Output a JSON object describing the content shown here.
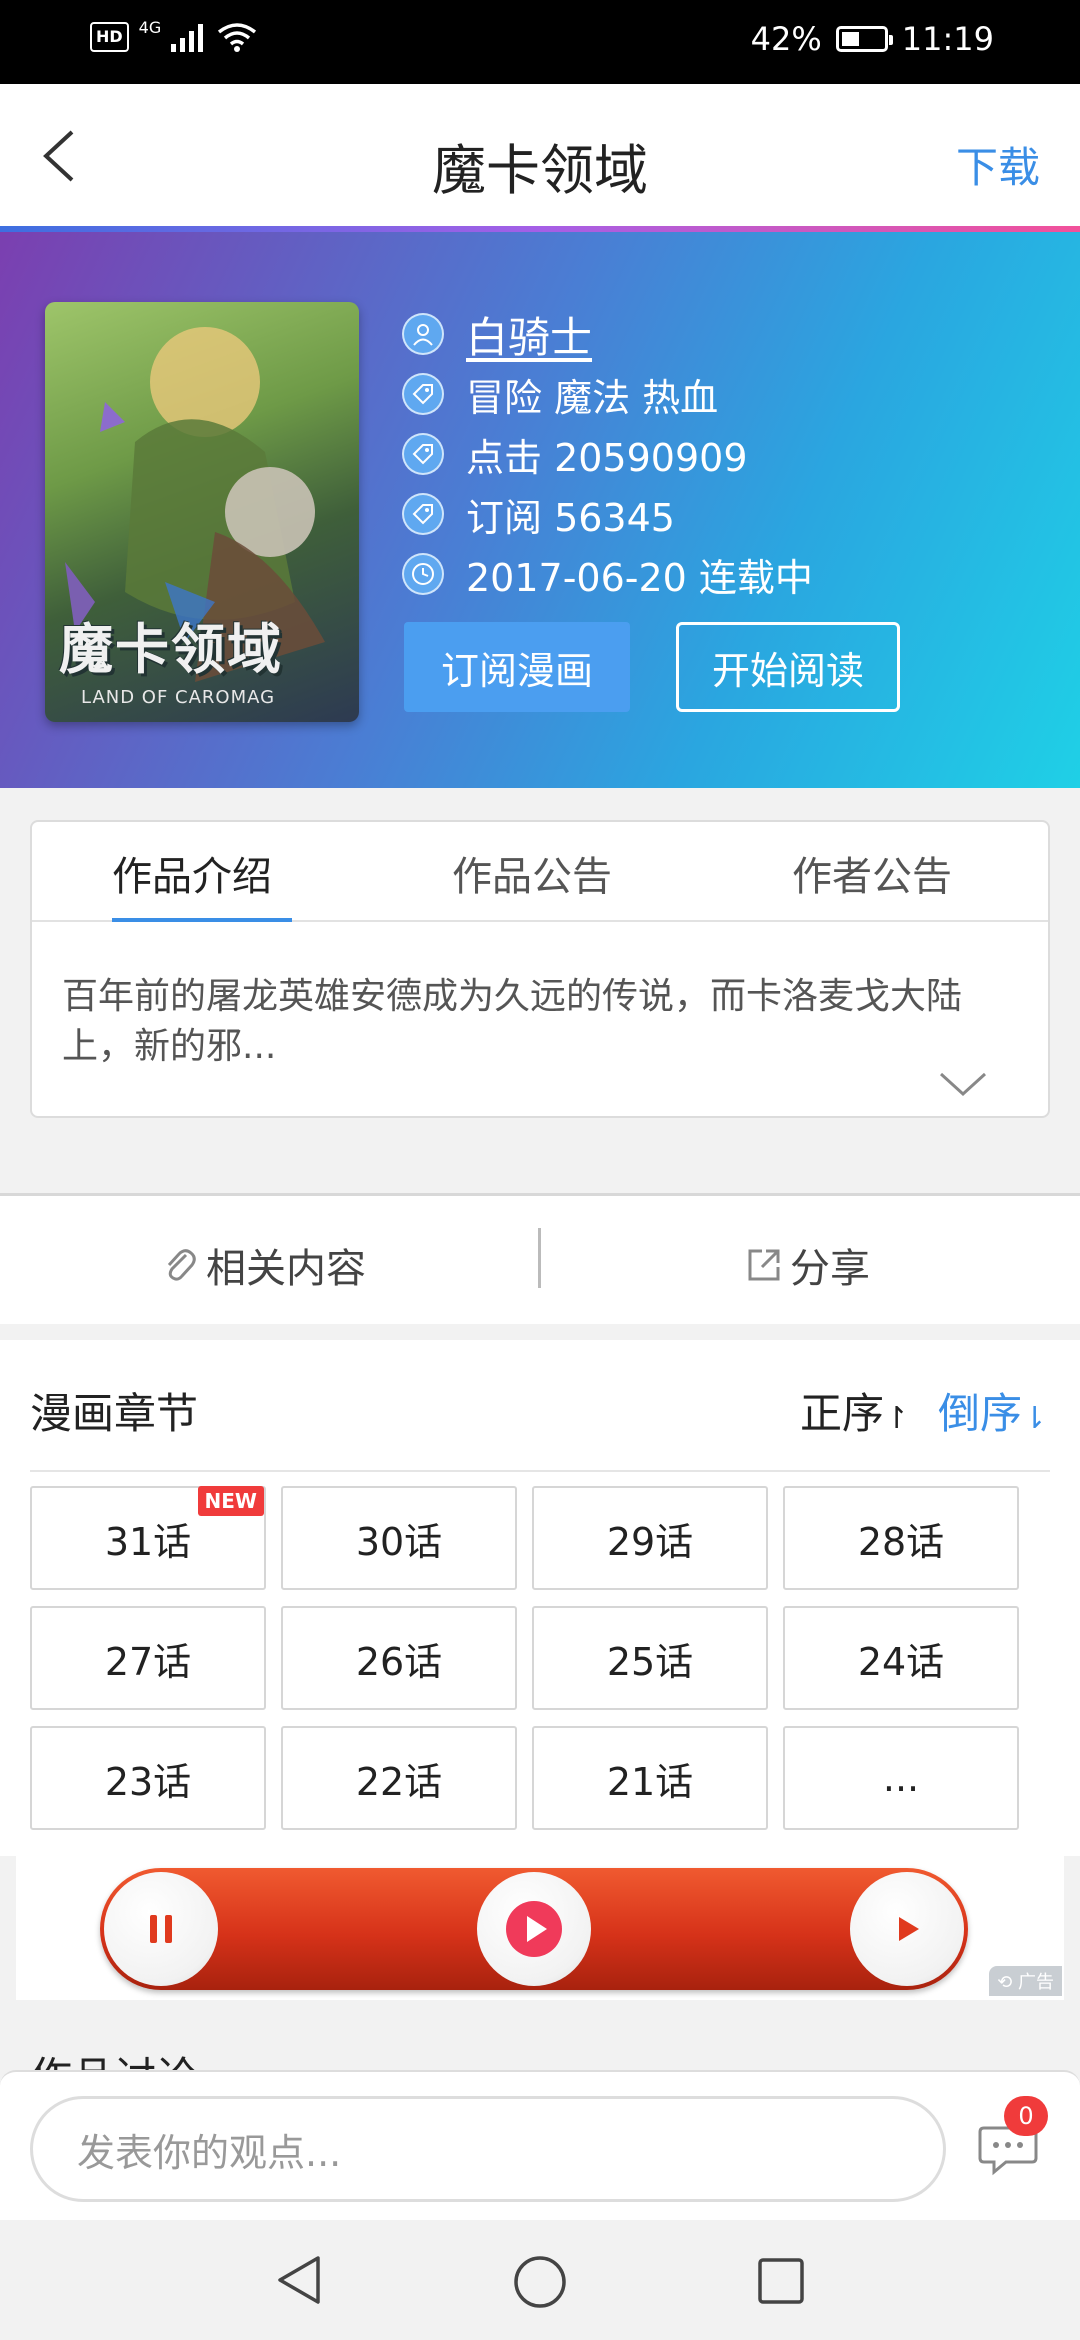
{
  "status_bar": {
    "hd": "HD",
    "network": "4G",
    "battery": "42%",
    "battery_level": 0.42,
    "time": "11:19"
  },
  "nav": {
    "title": "魔卡领域",
    "download": "下载"
  },
  "comic": {
    "cover_title": "魔卡领域",
    "cover_subtitle": "LAND OF CAROMAG",
    "author": "白骑士",
    "tags": "冒险 魔法 热血",
    "clicks": "点击 20590909",
    "subscriptions": "订阅 56345",
    "date_status": "2017-06-20 连载中",
    "subscribe_button": "订阅漫画",
    "read_button": "开始阅读"
  },
  "intro": {
    "tabs": [
      "作品介绍",
      "作品公告",
      "作者公告"
    ],
    "active_tab": 0,
    "text": "百年前的屠龙英雄安德成为久远的传说，而卡洛麦戈大陆上，新的邪..."
  },
  "actions": {
    "related": "相关内容",
    "share": "分享"
  },
  "chapters": {
    "title": "漫画章节",
    "sort_asc": "正序",
    "sort_desc": "倒序",
    "new_badge": "NEW",
    "items": [
      "31话",
      "30话",
      "29话",
      "28话",
      "27话",
      "26话",
      "25话",
      "24话",
      "23话",
      "22话",
      "21话",
      "..."
    ]
  },
  "ad": {
    "tag": "广告"
  },
  "discussion": {
    "title": "作品讨论"
  },
  "comment": {
    "placeholder": "发表你的观点...",
    "message_count": "0"
  },
  "colors": {
    "accent": "#3a8ee6",
    "badge": "#f03b3b"
  }
}
